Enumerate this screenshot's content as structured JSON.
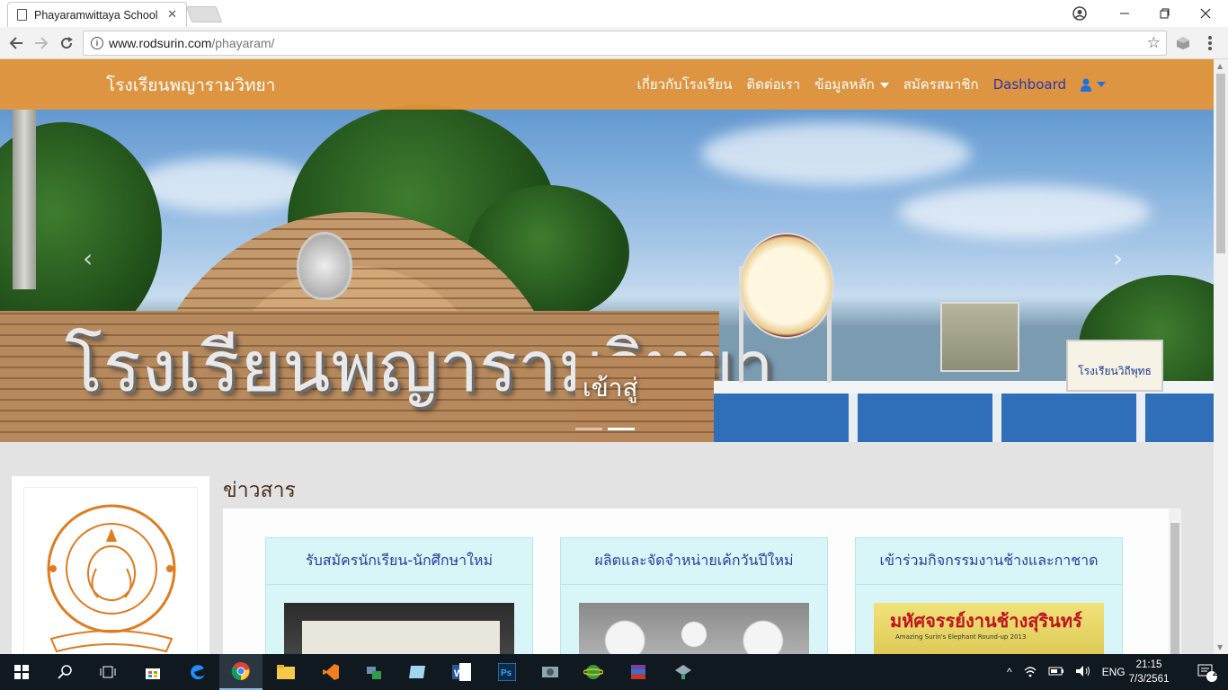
{
  "browser": {
    "tab_title": "Phayaramwittaya School",
    "tab_close": "✕",
    "url_host": "www.rodsurin.com",
    "url_path": "/phayaram/",
    "window_controls": [
      "minimize",
      "maximize",
      "close"
    ]
  },
  "navbar": {
    "brand": "โรงเรียนพญารามวิทยา",
    "links": {
      "about": "เกี่ยวกับโรงเรียน",
      "contact": "ติดต่อเรา",
      "main_data": "ข้อมูลหลัก",
      "register": "สมัครสมาชิก",
      "dashboard": "Dashboard"
    }
  },
  "hero": {
    "sign_text": "โรงเรียนพญารามวิทยา",
    "caption": "เข้าสู่",
    "board_text": "โรงเรียนวิถีพุทธ",
    "slides_count": 2,
    "active_slide": 2
  },
  "news": {
    "title": "ข่าวสาร",
    "cards": [
      {
        "title": "รับสมัครนักเรียน-นักศึกษาใหม่",
        "image_icon": "photo-icon"
      },
      {
        "title": "ผลิตและจัดจำหน่ายเค้กวันปีใหม่",
        "image_icon": "photo-icon"
      },
      {
        "title": "เข้าร่วมกิจกรรมงานช้างและกาชาด",
        "image_icon": "photo-icon",
        "image_text": "มหัศจรรย์งานช้างสุรินทร์",
        "image_subtext": "Amazing Surin's Elephant Round-up 2013"
      }
    ]
  },
  "taskbar": {
    "language": "ENG",
    "time": "21:15",
    "date": "7/3/2561",
    "notification_count": "2"
  },
  "colors": {
    "navbar": "#E7963A",
    "card_bg": "#D8F6F8",
    "card_title": "#2D3A9E",
    "dashboard_link": "#2A37A8"
  }
}
